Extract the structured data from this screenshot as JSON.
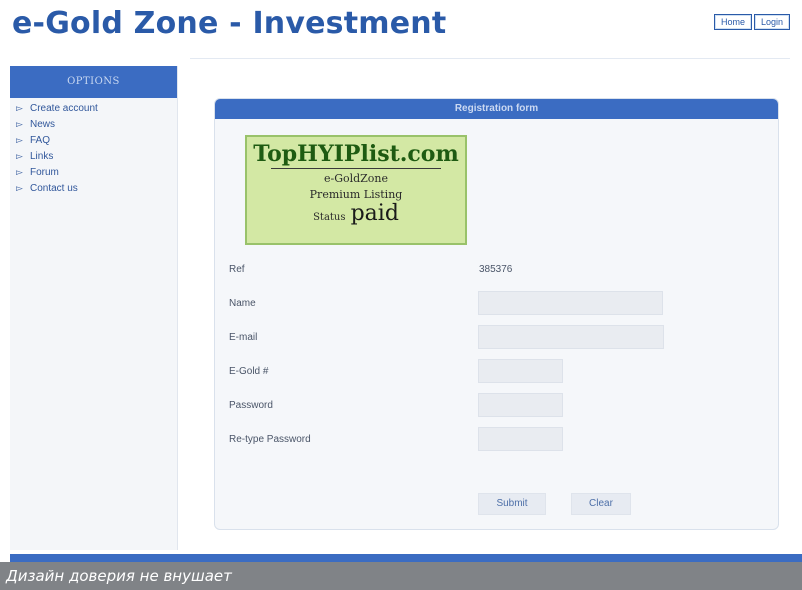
{
  "header": {
    "title": "e-Gold Zone - Investment",
    "nav": [
      {
        "label": "Home"
      },
      {
        "label": "Login"
      }
    ]
  },
  "sidebar": {
    "header": "OPTIONS",
    "items": [
      {
        "label": "Create account"
      },
      {
        "label": "News"
      },
      {
        "label": "FAQ"
      },
      {
        "label": "Links"
      },
      {
        "label": "Forum"
      },
      {
        "label": "Contact us"
      }
    ]
  },
  "form": {
    "title": "Registration form",
    "badge": {
      "site": "TopHYIPlist.com",
      "name": "e-GoldZone",
      "listing": "Premium Listing",
      "status_label": "Status",
      "status_value": "paid"
    },
    "ref": {
      "label": "Ref",
      "value": "385376"
    },
    "fields": [
      {
        "label": "Name",
        "value": ""
      },
      {
        "label": "E-mail",
        "value": ""
      },
      {
        "label": "E-Gold #",
        "value": ""
      },
      {
        "label": "Password",
        "value": ""
      },
      {
        "label": "Re-type Password",
        "value": ""
      }
    ],
    "submit_label": "Submit",
    "clear_label": "Clear"
  },
  "caption": "Дизайн доверия не внушает",
  "colors": {
    "brand_blue": "#3b6cc2",
    "title_blue": "#2a5aa8",
    "badge_green": "#d3e8a4",
    "caption_gray": "#808387"
  },
  "icons": {
    "sidebar_bullet": "arrow-bullet-icon"
  }
}
